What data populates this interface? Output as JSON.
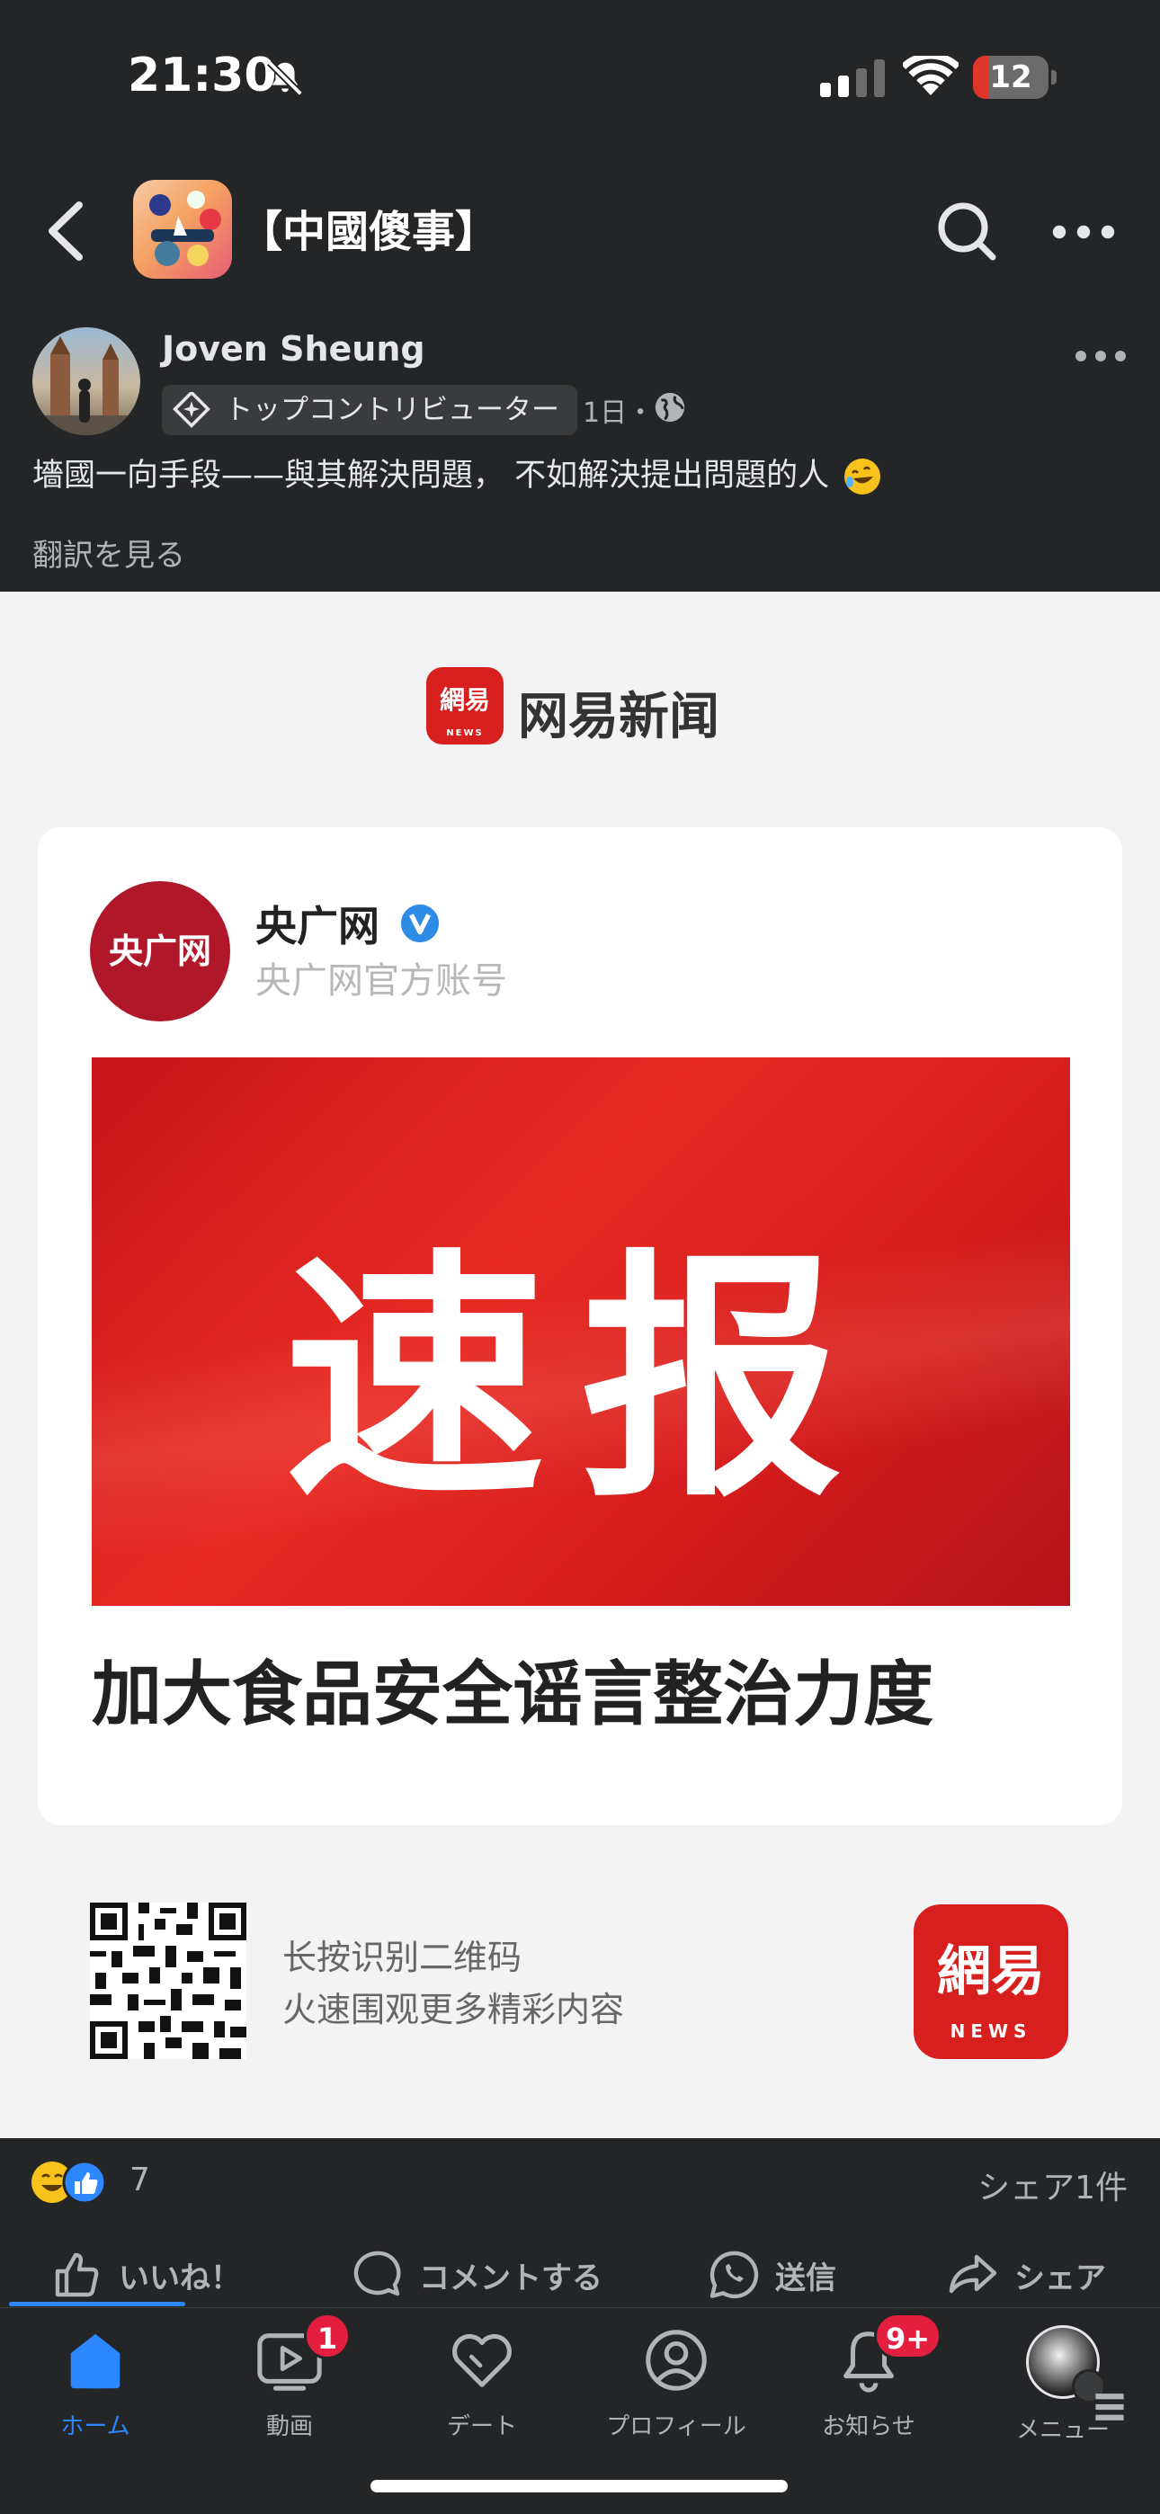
{
  "status_bar": {
    "time": "21:30",
    "battery": "12",
    "battery_level": 0.12
  },
  "nav": {
    "group_title": "【中國傻事】"
  },
  "post": {
    "author": "Joven Sheung",
    "badge": "トップコントリビューター",
    "meta": "1日・",
    "text": "墻國一向手段——與其解決問題，  不如解決提出問題的人",
    "translate": "翻訳を見る"
  },
  "image": {
    "brand_logo": "網易",
    "brand_logo_sub": "NEWS",
    "brand_title": "网易新闻",
    "account_logo": "央广网",
    "account_name": "央广网",
    "account_sub": "央广网官方账号",
    "banner_text": "速报",
    "headline": "加大食品安全谣言整治力度",
    "qr_line1": "长按识别二维码",
    "qr_line2": "火速围观更多精彩内容"
  },
  "reactions": {
    "count": "7",
    "shares": "シェア1件"
  },
  "actions": {
    "like": "いいね！",
    "comment": "コメントする",
    "send": "送信",
    "share": "シェア"
  },
  "tabs": {
    "home": "ホーム",
    "video": "動画",
    "video_badge": "1",
    "date": "デート",
    "profile": "プロフィール",
    "notifications": "お知らせ",
    "notifications_badge": "9+",
    "menu": "メニュー"
  },
  "colors": {
    "accent": "#2d88ff",
    "badge_red": "#e41e3f",
    "netease_red": "#d7201d",
    "banner_red": "#e62a23"
  }
}
